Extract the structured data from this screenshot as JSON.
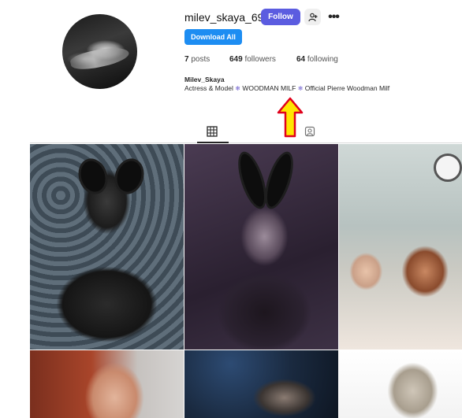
{
  "profile": {
    "username": "milev_skaya_69",
    "follow_label": "Follow",
    "more_label": "•••",
    "download_label": "Download All",
    "stats": {
      "posts_count": "7",
      "posts_label": "posts",
      "followers_count": "649",
      "followers_label": "followers",
      "following_count": "64",
      "following_label": "following"
    },
    "full_name": "Milev_Skaya",
    "bio_prefix": "Actress & Model ",
    "bio_link1": "WOODMAN MILF",
    "bio_link2": "Official Pierre Woodman Milf",
    "bio_star": "❄"
  },
  "colors": {
    "follow_button": "#5b5ce0",
    "download_button": "#1d8df2",
    "arrow_fill": "#ffe600",
    "arrow_stroke": "#e0001b"
  },
  "icons": {
    "suggest": "person-add-icon",
    "posts_tab": "grid-icon",
    "tagged_tab": "tagged-person-icon"
  }
}
